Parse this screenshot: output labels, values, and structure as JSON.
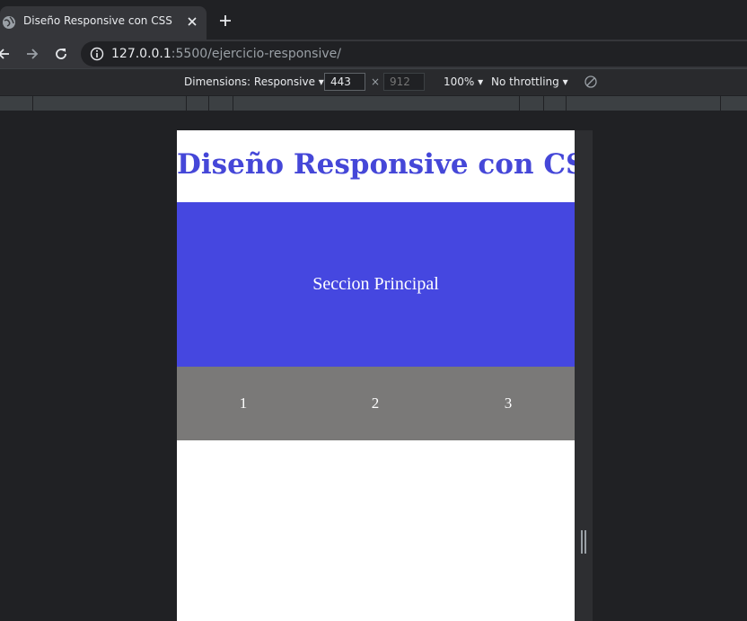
{
  "browser": {
    "tab": {
      "title": "Diseño Responsive con CSS"
    },
    "url": {
      "host": "127.0.0.1",
      "path": ":5500/ejercicio-responsive/"
    }
  },
  "devtools": {
    "dimensions_label": "Dimensions: Responsive",
    "width_value": "443",
    "height_placeholder": "912",
    "zoom_label": "100%",
    "throttling_label": "No throttling"
  },
  "page": {
    "title": "Diseño Responsive con CSS",
    "main_section_text": "Seccion Principal",
    "columns": [
      "1",
      "2",
      "3"
    ]
  },
  "colors": {
    "title": "#4547d8",
    "main_section_bg": "#4547e0",
    "columns_bg": "#7a7978"
  }
}
